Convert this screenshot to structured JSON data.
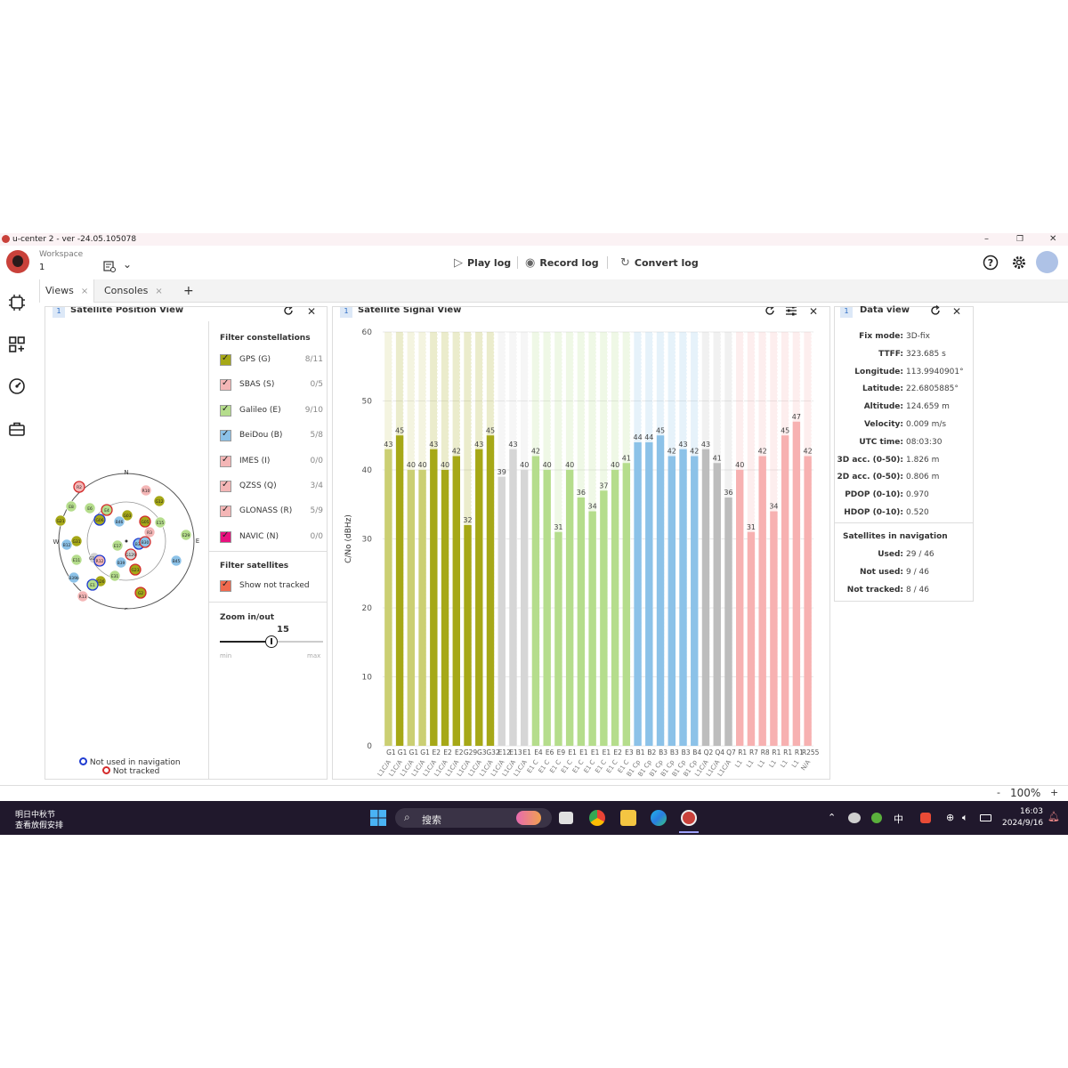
{
  "window": {
    "title": "u-center 2 - ver -24.05.105078",
    "min_label": "–",
    "restore_label": "❐",
    "close_label": "✕"
  },
  "header": {
    "workspace_label": "Workspace",
    "workspace_value": "1",
    "play_label": "Play log",
    "record_label": "Record log",
    "convert_label": "Convert log"
  },
  "tabs": [
    {
      "label": "Views",
      "close": "×"
    },
    {
      "label": "Consoles",
      "close": "×"
    },
    {
      "label": "+"
    }
  ],
  "position_view": {
    "title": "Satellite Position View",
    "number": "1",
    "compass": {
      "n": "N",
      "s": "S",
      "e": "E",
      "w": "W"
    },
    "satellites": [
      {
        "id": "R2",
        "color": "#f4b6b6"
      },
      {
        "id": "R10",
        "color": "#f4b6b6"
      },
      {
        "id": "G12",
        "color": "#a6a817"
      },
      {
        "id": "E8",
        "color": "#b5dd8c"
      },
      {
        "id": "E6",
        "color": "#b5dd8c"
      },
      {
        "id": "E4",
        "color": "#b5dd8c"
      },
      {
        "id": "G21",
        "color": "#a6a817"
      },
      {
        "id": "G06",
        "color": "#a6a817"
      },
      {
        "id": "G03",
        "color": "#a6a817"
      },
      {
        "id": "B46",
        "color": "#8cc2e8"
      },
      {
        "id": "G05",
        "color": "#a6a817"
      },
      {
        "id": "E15",
        "color": "#b5dd8c"
      },
      {
        "id": "G31",
        "color": "#a6a817"
      },
      {
        "id": "R3",
        "color": "#f4b6b6"
      },
      {
        "id": "B36",
        "color": "#8cc2e8"
      },
      {
        "id": "B30",
        "color": "#8cc2e8"
      },
      {
        "id": "G128",
        "color": "#d0d0d0"
      },
      {
        "id": "E17",
        "color": "#b5dd8c"
      },
      {
        "id": "B12",
        "color": "#8cc2e8"
      },
      {
        "id": "E11",
        "color": "#b5dd8c"
      },
      {
        "id": "G129",
        "color": "#d0d0d0"
      },
      {
        "id": "R12",
        "color": "#f4b6b6"
      },
      {
        "id": "B39",
        "color": "#8cc2e8"
      },
      {
        "id": "E31",
        "color": "#b5dd8c"
      },
      {
        "id": "G26",
        "color": "#a6a817"
      },
      {
        "id": "G23",
        "color": "#a6a817"
      },
      {
        "id": "E29",
        "color": "#b5dd8c"
      },
      {
        "id": "B45",
        "color": "#8cc2e8"
      },
      {
        "id": "E1",
        "color": "#b5dd8c"
      },
      {
        "id": "R13",
        "color": "#f4b6b6"
      },
      {
        "id": "G2",
        "color": "#a6a817"
      },
      {
        "id": "B39b",
        "color": "#8cc2e8"
      }
    ],
    "legend_not_used": "Not used in navigation",
    "legend_not_tracked": "Not tracked"
  },
  "filter": {
    "constellations_title": "Filter constellations",
    "items": [
      {
        "name": "GPS (G)",
        "count": "8/11",
        "color": "#a6a817"
      },
      {
        "name": "SBAS (S)",
        "count": "0/5",
        "color": "#f4b6b6"
      },
      {
        "name": "Galileo (E)",
        "count": "9/10",
        "color": "#b5dd8c"
      },
      {
        "name": "BeiDou (B)",
        "count": "5/8",
        "color": "#8cc2e8"
      },
      {
        "name": "IMES (I)",
        "count": "0/0",
        "color": "#f4b6b6"
      },
      {
        "name": "QZSS (Q)",
        "count": "3/4",
        "color": "#f4b6b6"
      },
      {
        "name": "GLONASS (R)",
        "count": "5/9",
        "color": "#f4b6b6"
      },
      {
        "name": "NAVIC (N)",
        "count": "0/0",
        "color": "#e8117f"
      }
    ],
    "satellites_title": "Filter satellites",
    "show_not_tracked": "Show not tracked",
    "show_not_tracked_color": "#f06a4e",
    "zoom_title": "Zoom in/out",
    "zoom_value": "15",
    "zoom_fraction": 0.5,
    "zoom_min": "min",
    "zoom_max": "max"
  },
  "signal_view": {
    "title": "Satellite Signal View",
    "number": "1"
  },
  "chart_data": {
    "type": "bar",
    "ylabel": "C/No (dBHz)",
    "ylim": [
      0,
      60
    ],
    "yticks": [
      0,
      10,
      20,
      30,
      40,
      50,
      60
    ],
    "grid": true,
    "values": [
      43,
      45,
      40,
      40,
      43,
      40,
      42,
      32,
      43,
      45,
      39,
      43,
      40,
      42,
      40,
      31,
      40,
      36,
      34,
      37,
      40,
      41,
      44,
      44,
      45,
      42,
      43,
      42,
      43,
      41,
      36,
      40,
      31,
      42,
      34,
      45,
      47,
      42
    ],
    "colors": [
      "#cbcf73",
      "#a6a817",
      "#cbcf73",
      "#cbcf73",
      "#a6a817",
      "#a6a817",
      "#a6a817",
      "#a6a817",
      "#a6a817",
      "#a6a817",
      "#d6d6d6",
      "#d6d6d6",
      "#d6d6d6",
      "#b5dd8c",
      "#b5dd8c",
      "#b5dd8c",
      "#b5dd8c",
      "#b5dd8c",
      "#b5dd8c",
      "#b5dd8c",
      "#b5dd8c",
      "#b5dd8c",
      "#8cc2e8",
      "#8cc2e8",
      "#8cc2e8",
      "#8cc2e8",
      "#8cc2e8",
      "#8cc2e8",
      "#bdbdbd",
      "#bdbdbd",
      "#bdbdbd",
      "#f7b1b1",
      "#f7b1b1",
      "#f7b1b1",
      "#f7b1b1",
      "#f7b1b1",
      "#f7b1b1",
      "#f7b1b1"
    ],
    "top_labels": [
      "G1",
      "G1",
      "G1",
      "G1",
      "E2",
      "E2",
      "E2",
      "G29",
      "G3",
      "G32",
      "E12",
      "E13",
      "E1",
      "E4",
      "E6",
      "E9",
      "E1",
      "E1",
      "E1",
      "E1",
      "E2",
      "E3",
      "B1",
      "B2",
      "B3",
      "B3",
      "B3",
      "B4",
      "Q2",
      "Q4",
      "Q7",
      "R1",
      "R7",
      "R8",
      "R1",
      "R1",
      "R1",
      "R255"
    ],
    "sig_labels": [
      "L1C/A",
      "L1C/A",
      "L1C/A",
      "L1C/A",
      "L1C/A",
      "L1C/A",
      "L1C/A",
      "L1C/A",
      "L1C/A",
      "L1C/A",
      "L1C/A",
      "L1C/A",
      "L1C/A",
      "E1 C",
      "E1 C",
      "E1 C",
      "E1 C",
      "E1 C",
      "E1 C",
      "E1 C",
      "E1 C",
      "E1 C",
      "B1 Cp",
      "B1 Cp",
      "B1 Cp",
      "B1 Cp",
      "B1 Cp",
      "B1 Cp",
      "L1C/A",
      "L1C/A",
      "L1C/A",
      "L1",
      "L1",
      "L1",
      "L1",
      "L1",
      "L1",
      "N/A"
    ]
  },
  "data_view": {
    "title": "Data view",
    "number": "1",
    "rows": [
      {
        "k": "Fix mode:",
        "v": "3D-fix"
      },
      {
        "k": "TTFF:",
        "v": "323.685 s"
      },
      {
        "k": "Longitude:",
        "v": "113.9940901°"
      },
      {
        "k": "Latitude:",
        "v": "22.6805885°"
      },
      {
        "k": "Altitude:",
        "v": "124.659 m"
      },
      {
        "k": "Velocity:",
        "v": "0.009 m/s"
      },
      {
        "k": "UTC time:",
        "v": "08:03:30"
      },
      {
        "k": "3D acc. (0-50):",
        "v": "1.826 m"
      },
      {
        "k": "2D acc. (0-50):",
        "v": "0.806 m"
      },
      {
        "k": "PDOP (0-10):",
        "v": "0.970"
      },
      {
        "k": "HDOP (0-10):",
        "v": "0.520"
      }
    ],
    "nav_title": "Satellites in navigation",
    "nav_rows": [
      {
        "k": "Used:",
        "v": "29 / 46"
      },
      {
        "k": "Not used:",
        "v": "9 / 46"
      },
      {
        "k": "Not tracked:",
        "v": "8 / 46"
      }
    ]
  },
  "statusbar": {
    "zoom_minus": "-",
    "zoom": "100%",
    "zoom_plus": "+"
  },
  "taskbar": {
    "news_line1": "明日中秋节",
    "news_line2": "查看放假安排",
    "search_placeholder": "搜索",
    "ime": "中",
    "time": "16:03",
    "date": "2024/9/16"
  }
}
